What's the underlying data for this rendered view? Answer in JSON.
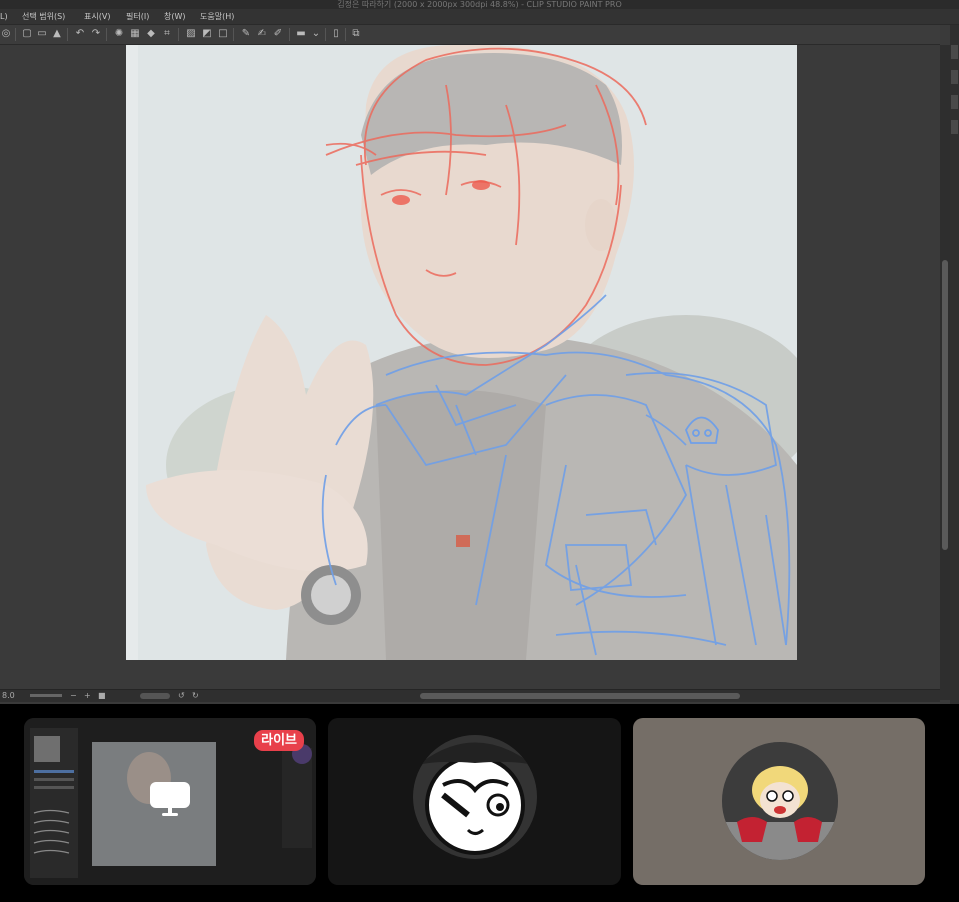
{
  "window": {
    "title": "김정은 따라하기 (2000 x 2000px 300dpi 48.8%) - CLIP STUDIO PAINT PRO"
  },
  "menu": {
    "items": [
      {
        "label": "L)"
      },
      {
        "label": "선택 범위(S)"
      },
      {
        "label": "표시(V)"
      },
      {
        "label": "필터(I)"
      },
      {
        "label": "창(W)"
      },
      {
        "label": "도움말(H)"
      }
    ]
  },
  "statusbar": {
    "zoom": "8.0"
  },
  "call": {
    "live_badge": "라이브"
  },
  "colors": {
    "live_badge": "#e8404b",
    "sketch_red": "#ec6a5c",
    "sketch_blue": "#6f9fe8",
    "tile3_bg": "#756e67"
  }
}
